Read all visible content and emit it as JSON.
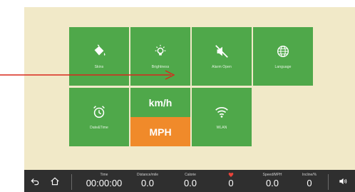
{
  "tiles": {
    "skins": "Skins",
    "brightness": "Brightness",
    "alarm": "Alarm Open",
    "language": "Language",
    "datetime": "Date&Time",
    "unit_top": "km/h",
    "unit_bottom": "MPH",
    "wlan": "WLAN"
  },
  "stats": {
    "time_label": "Time",
    "time_value": "00:00:00",
    "distance_label": "Distance/mile",
    "distance_value": "0.0",
    "calorie_label": "Calorie",
    "calorie_value": "0.0",
    "heart_value": "0",
    "speed_label": "Speed/MPH",
    "speed_value": "0.0",
    "incline_label": "Incline/%",
    "incline_value": "0"
  },
  "colors": {
    "tile": "#4fa84a",
    "selected_unit": "#f08a2a",
    "background": "#f1e9c8",
    "bar": "#2f2f2f",
    "arrow": "#d9281c",
    "heart": "#e8433a"
  },
  "icons": {
    "skins": "paint-bucket-icon",
    "brightness": "sun-bulb-icon",
    "alarm": "speaker-mute-icon",
    "language": "globe-icon",
    "datetime": "alarm-clock-icon",
    "wlan": "wifi-icon",
    "back": "back-arrow-icon",
    "home": "home-icon",
    "heart": "heart-icon",
    "volume": "volume-icon"
  }
}
